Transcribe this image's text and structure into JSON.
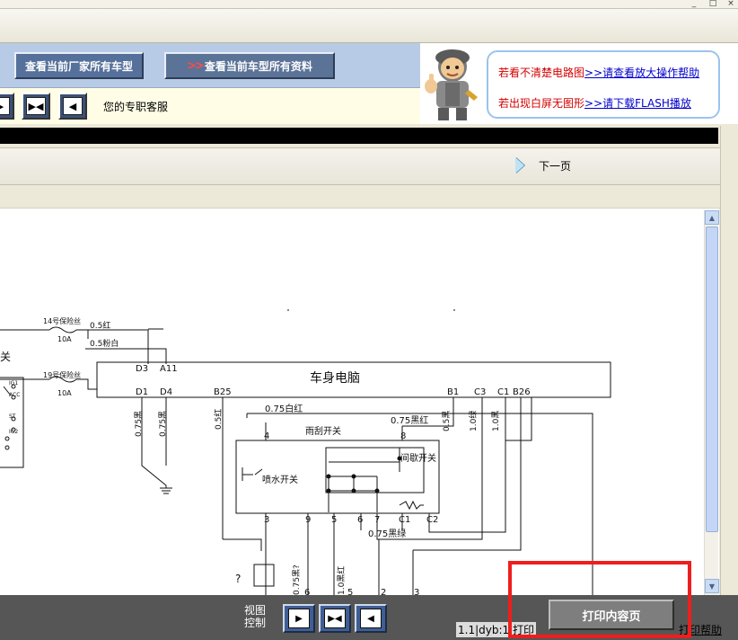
{
  "window": {
    "controls": [
      "_",
      "□",
      "×"
    ]
  },
  "header": {
    "btn_all_models": "查看当前厂家所有车型",
    "btn_all_docs_arrow": ">>",
    "btn_all_docs": "查看当前车型所有资料",
    "customer_service": "您的专职客服",
    "help": {
      "line1_prefix": "若看不清楚电路图",
      "line1_link": ">>请查看放大操作帮助",
      "line2_prefix": "若出现白屏无图形",
      "line2_link": ">>请下载FLASH播放"
    }
  },
  "pagenav": {
    "next_page": "下一页"
  },
  "diagram": {
    "title": "车身电脑",
    "fuse14": "14号保险丝",
    "fuse19": "19号保险丝",
    "fuse_amp": "10A",
    "wire_05_red": "0.5红",
    "wire_05_pinkwhite": "0.5粉白",
    "switch_cn": "关",
    "pins_top": [
      "D3",
      "A11"
    ],
    "pins_bottom": [
      "D1",
      "D4",
      "B25",
      "B1",
      "C3",
      "C1",
      "B26"
    ],
    "wiper_switch": "雨刮开关",
    "interval_switch": "间歇开关",
    "washer_switch": "喷水开关",
    "wire_075_white_red": "0.75白红",
    "wire_075_black_red": "0.75黑红",
    "wire_075_black_green": "0.75黑绿",
    "wire_075_black_1": "0.75黑",
    "wire_075_black_2": "0.75黑",
    "wire_05_red_v": "0.5红",
    "wire_05_black": "0.5黑",
    "wire_10_green": "1.0绿",
    "wire_10_black": "1.0黑",
    "wire_075_q": "0.75黑?",
    "wire_10_black_red": "1.0黑红",
    "terminal_nums": [
      "4",
      "8",
      "3",
      "9",
      "5",
      "6",
      "7",
      "C1",
      "C2"
    ],
    "bottom_nums": [
      "6",
      "5",
      "2",
      "3"
    ],
    "ign_labels": [
      "IG1",
      "ACC",
      "ST",
      "IG2"
    ],
    "question": "?"
  },
  "bottombar": {
    "view_label_1": "视图",
    "view_label_2": "控制",
    "page_info": "1.1|dyb:1 打印",
    "print_btn": "打印内容页",
    "print_help": "打印帮助"
  },
  "colors": {
    "header_blue": "#b8cbe6",
    "bottom_bar": "#565656",
    "highlight_red": "#ef1e1e",
    "link_blue": "#0000cc"
  }
}
